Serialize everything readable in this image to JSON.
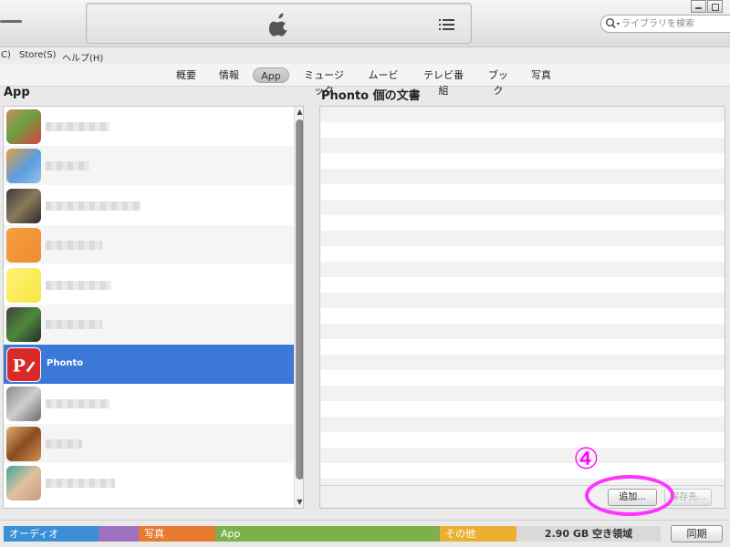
{
  "search": {
    "placeholder": "ライブラリを検索"
  },
  "menu": {
    "controls_fragment": "C)",
    "store": "Store(S)",
    "help": "ヘルプ(H)"
  },
  "tabs": [
    {
      "label": "概要"
    },
    {
      "label": "情報"
    },
    {
      "label": "App"
    },
    {
      "label": "ミュージック"
    },
    {
      "label": "ムービー"
    },
    {
      "label": "テレビ番組"
    },
    {
      "label": "ブック"
    },
    {
      "label": "写真"
    }
  ],
  "apps_panel": {
    "heading": "App",
    "selected_app": "Phonto"
  },
  "docs_panel": {
    "heading": "Phonto 個の文書",
    "add_button": "追加...",
    "save_button": "保存先..."
  },
  "annotation": {
    "number": "④"
  },
  "capacity": {
    "segments": [
      {
        "label": "オーディオ",
        "color": "#3a8fd6"
      },
      {
        "label": "",
        "color": "#a070c0"
      },
      {
        "label": "写真",
        "color": "#e87a2e"
      },
      {
        "label": "App",
        "color": "#7db04a"
      },
      {
        "label": "その他",
        "color": "#e9b031"
      }
    ],
    "free_label": "2.90 GB 空き領域",
    "sync_button": "同期"
  }
}
